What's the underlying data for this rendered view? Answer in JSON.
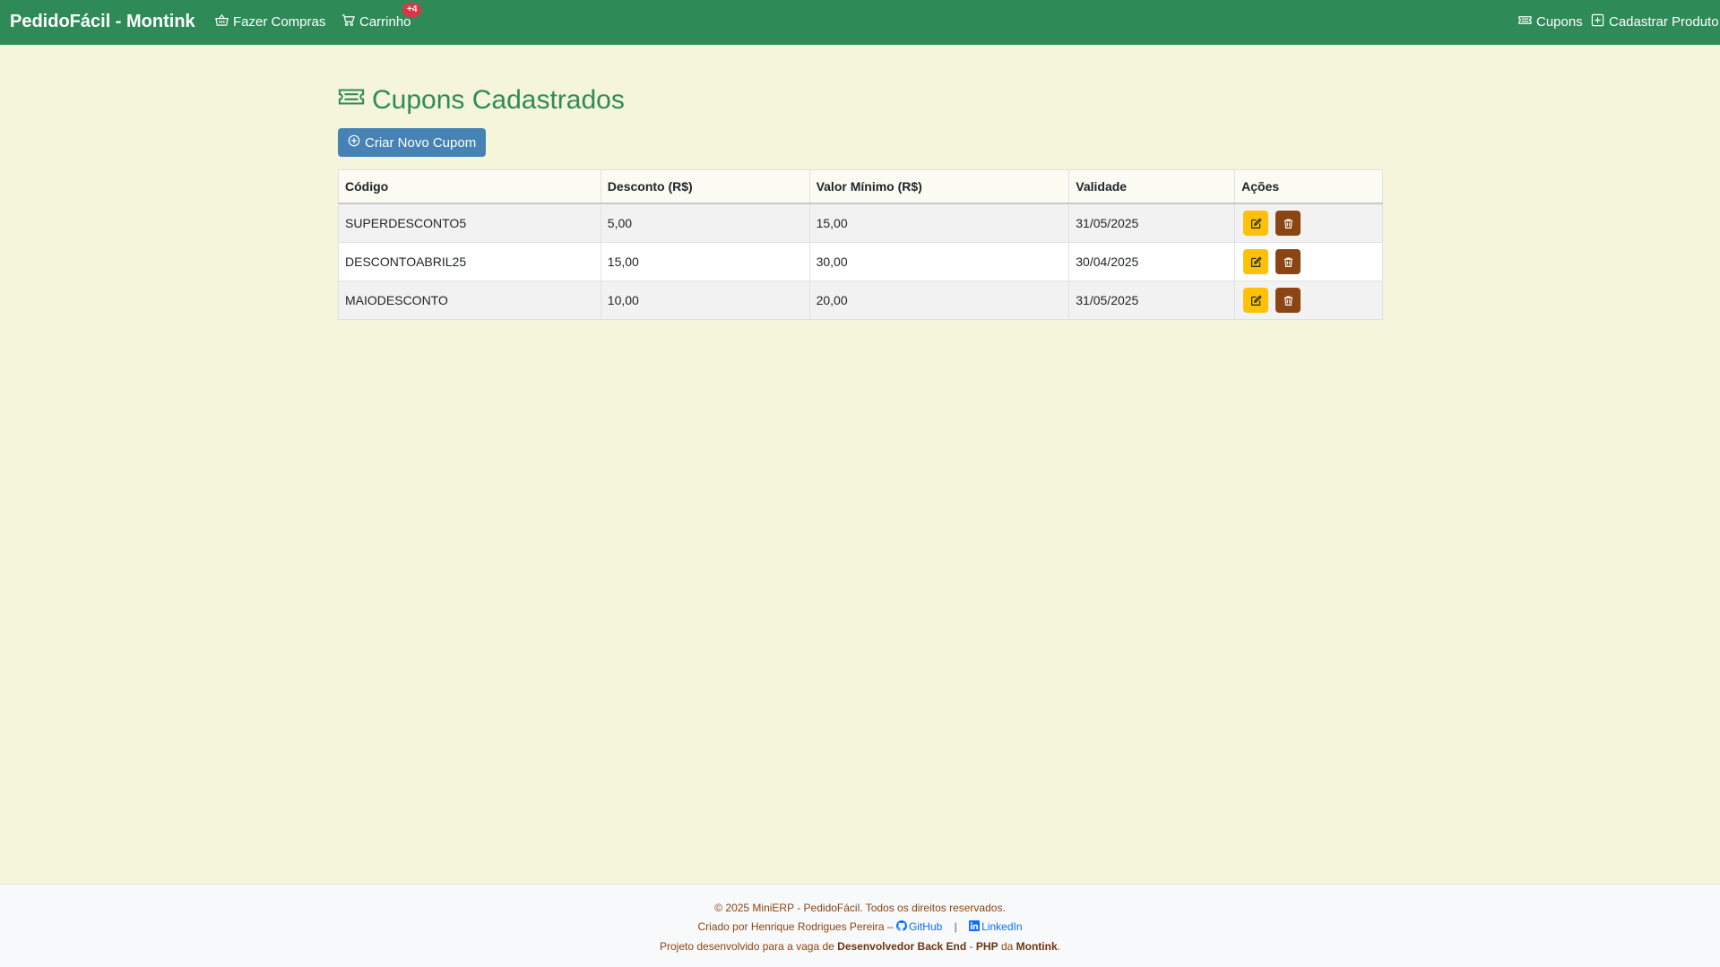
{
  "navbar": {
    "brand": "PedidoFácil - Montink",
    "shop_label": "Fazer Compras",
    "cart_label": "Carrinho",
    "cart_badge": "+4",
    "coupons_label": "Cupons",
    "add_product_label": "Cadastrar Produto"
  },
  "page": {
    "title": "Cupons Cadastrados",
    "new_button": "Criar Novo Cupom"
  },
  "table": {
    "headers": [
      "Código",
      "Desconto (R$)",
      "Valor Mínimo (R$)",
      "Validade",
      "Ações"
    ],
    "rows": [
      [
        "SUPERDESCONTO5",
        "5,00",
        "15,00",
        "31/05/2025"
      ],
      [
        "DESCONTOABRIL25",
        "15,00",
        "30,00",
        "30/04/2025"
      ],
      [
        "MAIODESCONTO",
        "10,00",
        "20,00",
        "31/05/2025"
      ]
    ]
  },
  "footer": {
    "copyright": "© 2025 MiniERP - PedidoFácil. Todos os direitos reservados.",
    "created_by": "Criado por Henrique Rodrigues Pereira –",
    "github": "GitHub",
    "separator": "|",
    "linkedin": "LinkedIn",
    "project_prefix": "Projeto desenvolvido para a vaga de",
    "role": "Desenvolvedor Back End",
    "dash": "-",
    "tech": "PHP",
    "da": "da",
    "company": "Montink",
    "period": "."
  },
  "colors": {
    "navbar": "#2e8b57",
    "background": "#f5f5dc",
    "primary_button": "#4682b4",
    "edit_button": "#ffc107",
    "delete_button": "#8b4513",
    "badge": "#dc3545"
  },
  "icons": {
    "shop": "basket-icon",
    "cart": "cart-icon",
    "coupons": "ticket-icon",
    "add_product": "plus-square-icon",
    "new": "plus-circle-icon",
    "edit": "pencil-square-icon",
    "delete": "trash-icon",
    "github": "github-icon",
    "linkedin": "linkedin-icon"
  }
}
